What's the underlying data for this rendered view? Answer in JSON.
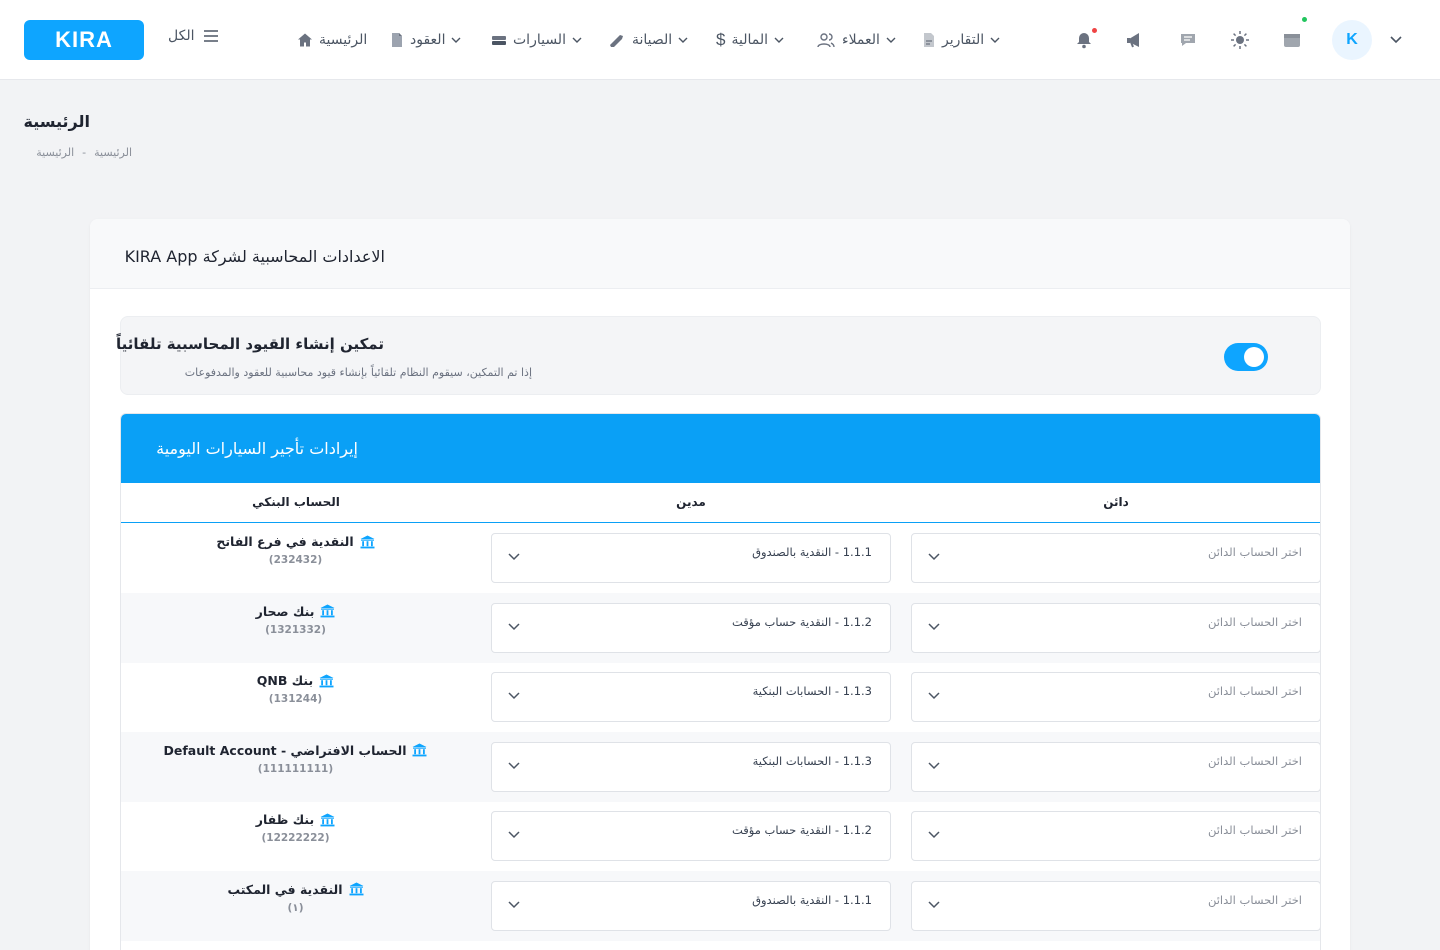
{
  "brand": {
    "logo_text": "KIRA",
    "accent": "#0ea5ff"
  },
  "header": {
    "all_label": "الكل",
    "nav": [
      {
        "label": "الرئيسية",
        "icon": "home-icon",
        "dropdown": false
      },
      {
        "label": "العقود",
        "icon": "document-icon",
        "dropdown": true
      },
      {
        "label": "السيارات",
        "icon": "car-icon",
        "dropdown": true
      },
      {
        "label": "الصيانة",
        "icon": "wrench-icon",
        "dropdown": true
      },
      {
        "label": "المالية",
        "icon": "dollar-icon",
        "dropdown": true
      },
      {
        "label": "العملاء",
        "icon": "users-icon",
        "dropdown": true
      },
      {
        "label": "التقارير",
        "icon": "report-icon",
        "dropdown": true
      }
    ],
    "user_initial": "K"
  },
  "page": {
    "title": "الرئيسية",
    "breadcrumb": [
      "الرئيسية",
      "الرئيسية"
    ],
    "breadcrumb_separator": "-"
  },
  "settings": {
    "title": "الاعدادات المحاسبية لشركة KIRA App",
    "auto_entries": {
      "label": "تمكين إنشاء القيود المحاسبية تلقائياً",
      "description": "إذا تم التمكين، سيقوم النظام تلقائياً بإنشاء قيود محاسبية للعقود والمدفوعات",
      "enabled": true
    },
    "section": {
      "title": "إيرادات تأجير السيارات اليومية",
      "columns": {
        "bank": "الحساب البنكي",
        "debit": "مدين",
        "credit": "دائن"
      },
      "rows": [
        {
          "bank": "النقدية في فرع الفاتح",
          "account": "(232432)",
          "debit": "1.1.1 - النقدية بالصندوق",
          "credit": "اختر الحساب الدائن"
        },
        {
          "bank": "بنك صحار",
          "account": "(1321332)",
          "debit": "1.1.2 - النقدية حساب مؤقت",
          "credit": "اختر الحساب الدائن"
        },
        {
          "bank": "بنك QNB",
          "account": "(131244)",
          "debit": "1.1.3 - الحسابات البنكية",
          "credit": "اختر الحساب الدائن"
        },
        {
          "bank": "الحساب الافتراضي - Default Account",
          "account": "(111111111)",
          "debit": "1.1.3 - الحسابات البنكية",
          "credit": "اختر الحساب الدائن"
        },
        {
          "bank": "بنك ظفار",
          "account": "(12222222)",
          "debit": "1.1.2 - النقدية حساب مؤقت",
          "credit": "اختر الحساب الدائن"
        },
        {
          "bank": "النقدية في المكتب",
          "account": "(١)",
          "debit": "1.1.1 - النقدية بالصندوق",
          "credit": "اختر الحساب الدائن"
        }
      ]
    }
  }
}
